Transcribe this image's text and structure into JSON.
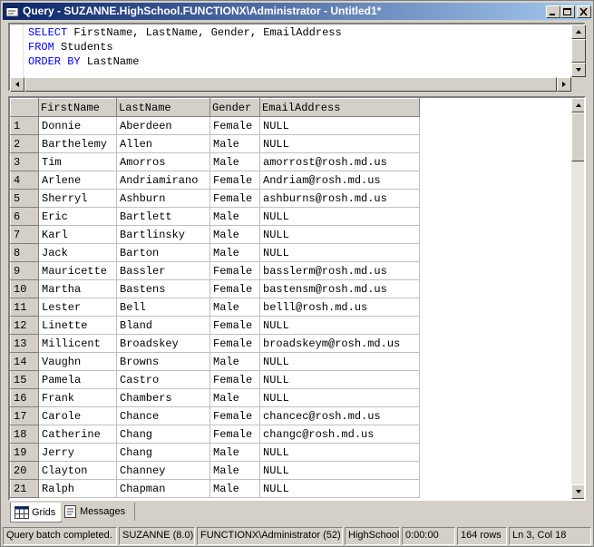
{
  "window": {
    "title": "Query - SUZANNE.HighSchool.FUNCTIONX\\Administrator - Untitled1*"
  },
  "editor": {
    "lines": [
      {
        "kw": "SELECT",
        "rest": " FirstName, LastName, Gender, EmailAddress"
      },
      {
        "kw": "FROM",
        "rest": " Students"
      },
      {
        "kw": "ORDER BY",
        "rest": " LastName"
      }
    ]
  },
  "grid": {
    "columns": [
      "FirstName",
      "LastName",
      "Gender",
      "EmailAddress"
    ],
    "rows": [
      [
        "1",
        "Donnie",
        "Aberdeen",
        "Female",
        "NULL"
      ],
      [
        "2",
        "Barthelemy",
        "Allen",
        "Male",
        "NULL"
      ],
      [
        "3",
        "Tim",
        "Amorros",
        "Male",
        "amorrost@rosh.md.us"
      ],
      [
        "4",
        "Arlene",
        "Andriamirano",
        "Female",
        "Andriam@rosh.md.us"
      ],
      [
        "5",
        "Sherryl",
        "Ashburn",
        "Female",
        "ashburns@rosh.md.us"
      ],
      [
        "6",
        "Eric",
        "Bartlett",
        "Male",
        "NULL"
      ],
      [
        "7",
        "Karl",
        "Bartlinsky",
        "Male",
        "NULL"
      ],
      [
        "8",
        "Jack",
        "Barton",
        "Male",
        "NULL"
      ],
      [
        "9",
        "Mauricette",
        "Bassler",
        "Female",
        "basslerm@rosh.md.us"
      ],
      [
        "10",
        "Martha",
        "Bastens",
        "Female",
        "bastensm@rosh.md.us"
      ],
      [
        "11",
        "Lester",
        "Bell",
        "Male",
        "belll@rosh.md.us"
      ],
      [
        "12",
        "Linette",
        "Bland",
        "Female",
        "NULL"
      ],
      [
        "13",
        "Millicent",
        "Broadskey",
        "Female",
        "broadskeym@rosh.md.us"
      ],
      [
        "14",
        "Vaughn",
        "Browns",
        "Male",
        "NULL"
      ],
      [
        "15",
        "Pamela",
        "Castro",
        "Female",
        "NULL"
      ],
      [
        "16",
        "Frank",
        "Chambers",
        "Male",
        "NULL"
      ],
      [
        "17",
        "Carole",
        "Chance",
        "Female",
        "chancec@rosh.md.us"
      ],
      [
        "18",
        "Catherine",
        "Chang",
        "Female",
        "changc@rosh.md.us"
      ],
      [
        "19",
        "Jerry",
        "Chang",
        "Male",
        "NULL"
      ],
      [
        "20",
        "Clayton",
        "Channey",
        "Male",
        "NULL"
      ],
      [
        "21",
        "Ralph",
        "Chapman",
        "Male",
        "NULL"
      ]
    ]
  },
  "tabs": {
    "grids": "Grids",
    "messages": "Messages"
  },
  "status": {
    "message": "Query batch completed.",
    "server": "SUZANNE (8.0)",
    "user": "FUNCTIONX\\Administrator (52)",
    "database": "HighSchool",
    "elapsed": "0:00:00",
    "rows": "164 rows",
    "position": "Ln 3, Col 18"
  },
  "icons": {
    "app": "query-window-icon",
    "minimize": "minimize-icon",
    "maximize": "maximize-icon",
    "close": "close-icon",
    "grids_tab": "grid-icon",
    "messages_tab": "messages-icon"
  },
  "colors": {
    "titlebar_start": "#0a246a",
    "titlebar_end": "#a6caf0",
    "keyword": "#0000ff",
    "chrome": "#d4d0c8"
  }
}
